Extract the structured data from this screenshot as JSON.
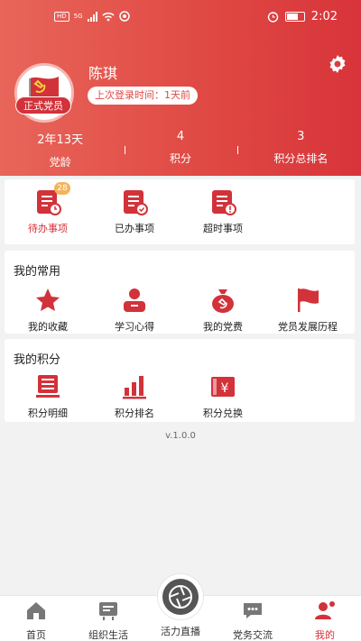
{
  "status_bar": {
    "time": "2:02",
    "network_chip": "HD",
    "network_type": "5G"
  },
  "profile": {
    "name": "陈琪",
    "badge": "正式党员",
    "last_login_label": "上次登录时间：",
    "last_login_value": "1天前",
    "settings_icon": "gear-icon"
  },
  "stats": [
    {
      "value": "2年13天",
      "label": "党龄"
    },
    {
      "value": "4",
      "label": "积分"
    },
    {
      "value": "3",
      "label": "积分总排名"
    }
  ],
  "tasks": [
    {
      "label": "待办事项",
      "icon": "todo-doc-icon",
      "badge": "28",
      "active": true
    },
    {
      "label": "已办事项",
      "icon": "done-doc-icon"
    },
    {
      "label": "超时事项",
      "icon": "overdue-doc-icon"
    }
  ],
  "favorites": {
    "title": "我的常用",
    "items": [
      {
        "label": "我的收藏",
        "icon": "star-icon"
      },
      {
        "label": "学习心得",
        "icon": "person-card-icon"
      },
      {
        "label": "我的党费",
        "icon": "money-bag-icon"
      },
      {
        "label": "党员发展历程",
        "icon": "flag-icon"
      }
    ]
  },
  "points": {
    "title": "我的积分",
    "items": [
      {
        "label": "积分明细",
        "icon": "monitor-icon"
      },
      {
        "label": "积分排名",
        "icon": "bar-chart-icon"
      },
      {
        "label": "积分兑换",
        "icon": "yen-ticket-icon"
      }
    ]
  },
  "version": "v.1.0.0",
  "tabbar": [
    {
      "label": "首页",
      "icon": "home-icon"
    },
    {
      "label": "组织生活",
      "icon": "board-icon"
    },
    {
      "label": "活力直播",
      "icon": "camera-aperture-icon"
    },
    {
      "label": "党务交流",
      "icon": "chat-icon"
    },
    {
      "label": "我的",
      "icon": "user-icon",
      "active": true
    }
  ],
  "colors": {
    "accent": "#d2323a",
    "header_start": "#e8655a",
    "header_end": "#d8343a",
    "badge": "#f4b45a"
  }
}
